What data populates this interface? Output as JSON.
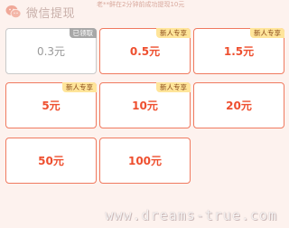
{
  "header": {
    "title": "微信提现",
    "ticker": "老**鲜在2分钟前成功提现10元"
  },
  "cards": [
    {
      "amount": "0.3元",
      "tag": "已领取",
      "claimed": true
    },
    {
      "amount": "0.5元",
      "tag": "新人专享",
      "claimed": false
    },
    {
      "amount": "1.5元",
      "tag": "新人专享",
      "claimed": false
    },
    {
      "amount": "5元",
      "tag": "新人专享",
      "claimed": false
    },
    {
      "amount": "10元",
      "tag": "新人专享",
      "claimed": false
    },
    {
      "amount": "20元",
      "tag": "",
      "claimed": false
    },
    {
      "amount": "50元",
      "tag": "",
      "claimed": false
    },
    {
      "amount": "100元",
      "tag": "",
      "claimed": false
    }
  ],
  "watermark": "www.dreams-true.com",
  "colors": {
    "accent": "#ee4f2f",
    "border": "#f07a5f",
    "tag_bg": "#ffe59a",
    "claimed_tag_bg": "#a8a8a8"
  },
  "icons": {
    "header": "wechat-icon"
  }
}
